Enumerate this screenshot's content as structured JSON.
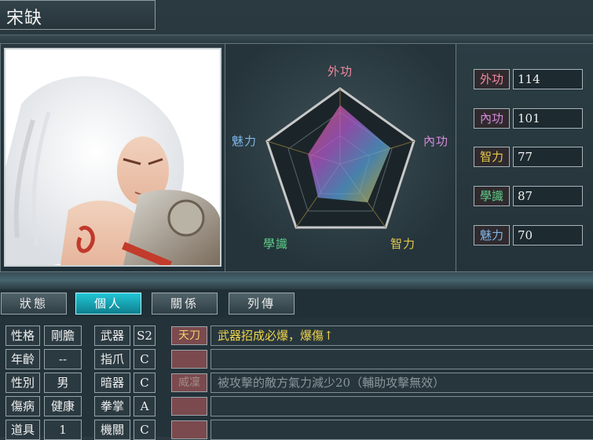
{
  "character": {
    "name": "宋缺"
  },
  "radar": {
    "labels": {
      "top": "外功",
      "right": "內功",
      "bottom_right": "智力",
      "bottom_left": "學識",
      "left": "魅力"
    },
    "colors": {
      "top": "#f08aa0",
      "right": "#d48ad8",
      "bottom_right": "#e7c84a",
      "bottom_left": "#5fd08a",
      "left": "#7fb6e8"
    }
  },
  "stats": [
    {
      "label": "外功",
      "value": "114"
    },
    {
      "label": "內功",
      "value": "101"
    },
    {
      "label": "智力",
      "value": "77"
    },
    {
      "label": "學識",
      "value": "87"
    },
    {
      "label": "魅力",
      "value": "70"
    }
  ],
  "tabs": [
    {
      "label": "狀態"
    },
    {
      "label": "個人"
    },
    {
      "label": "關係"
    },
    {
      "label": "列傳"
    }
  ],
  "active_tab": "個人",
  "personal": [
    {
      "label": "性格",
      "value": "剛膽"
    },
    {
      "label": "年齡",
      "value": "--"
    },
    {
      "label": "性別",
      "value": "男"
    },
    {
      "label": "傷病",
      "value": "健康"
    },
    {
      "label": "道具",
      "value": "1"
    }
  ],
  "skills": [
    {
      "label": "武器",
      "grade": "S2",
      "tag": "天刀",
      "desc": "武器招成必爆，爆傷↑"
    },
    {
      "label": "指爪",
      "grade": "C",
      "tag": "",
      "desc": ""
    },
    {
      "label": "暗器",
      "grade": "C",
      "tag": "威凜",
      "desc": "被攻擊的敵方氣力減少20（輔助攻擊無效）"
    },
    {
      "label": "拳掌",
      "grade": "A",
      "tag": "",
      "desc": ""
    },
    {
      "label": "機關",
      "grade": "C",
      "tag": "",
      "desc": ""
    }
  ]
}
